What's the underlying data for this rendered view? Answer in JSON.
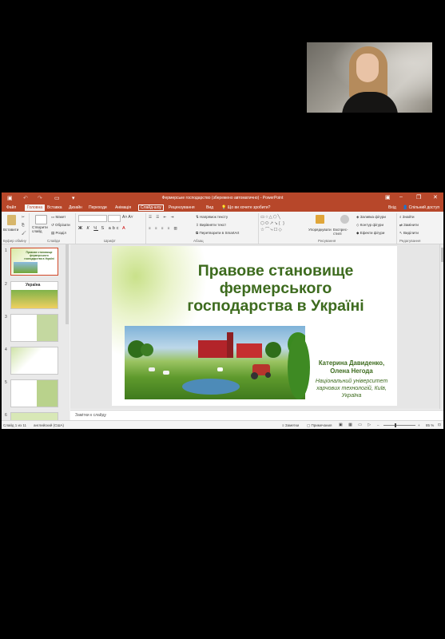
{
  "window": {
    "title": "Фермерське господарство (збережено автоматично) - PowerPoint",
    "tell_me": "Що ви хочете зробити?",
    "sign_in": "Вхід",
    "share": "Спільний доступ"
  },
  "tabs": [
    "Файл",
    "Головна",
    "Вставка",
    "Дизайн",
    "Переходи",
    "Анімація",
    "Слайд-шоу",
    "Рецензування",
    "Вид"
  ],
  "ribbon": {
    "paste": "Вставити",
    "new_slide": "Створити слайд",
    "layout": "Макет",
    "reset": "Обрізати",
    "section": "Розділ",
    "text_direction": "Напрямок тексту",
    "align_text": "Вирівняти текст",
    "smartart": "Перетворити в SmartArt",
    "arrange": "Упорядкувати",
    "quick_styles": "Експрес-стилі",
    "fill": "Заливка фігури",
    "outline": "Контур фігури",
    "effects": "Ефекти фігури",
    "find": "Знайти",
    "replace": "Замінити",
    "select": "Виділити",
    "groups": {
      "clipboard": "Буфер обміну",
      "slides": "Слайди",
      "font": "Шрифт",
      "paragraph": "Абзац",
      "drawing": "Рисування",
      "editing": "Редагування"
    }
  },
  "slide": {
    "title_lines": [
      "Правове становище",
      "фермерського",
      "господарства в Україні"
    ],
    "authors": [
      "Катерина Давиденко,",
      "Олена Негода"
    ],
    "institution": [
      "Національний університет",
      "харчових технологій, Київ,",
      "Україна"
    ]
  },
  "thumbnails": {
    "numbers": [
      "1",
      "2",
      "3",
      "4",
      "5",
      "6"
    ],
    "slide2_title": "Україна"
  },
  "notes_placeholder": "Замітки к слайду",
  "status": {
    "slide_info": "Слайд 1 из 11",
    "language": "английский (США)",
    "notes_btn": "Заметки",
    "comments_btn": "Примечания",
    "zoom": "85 %"
  }
}
